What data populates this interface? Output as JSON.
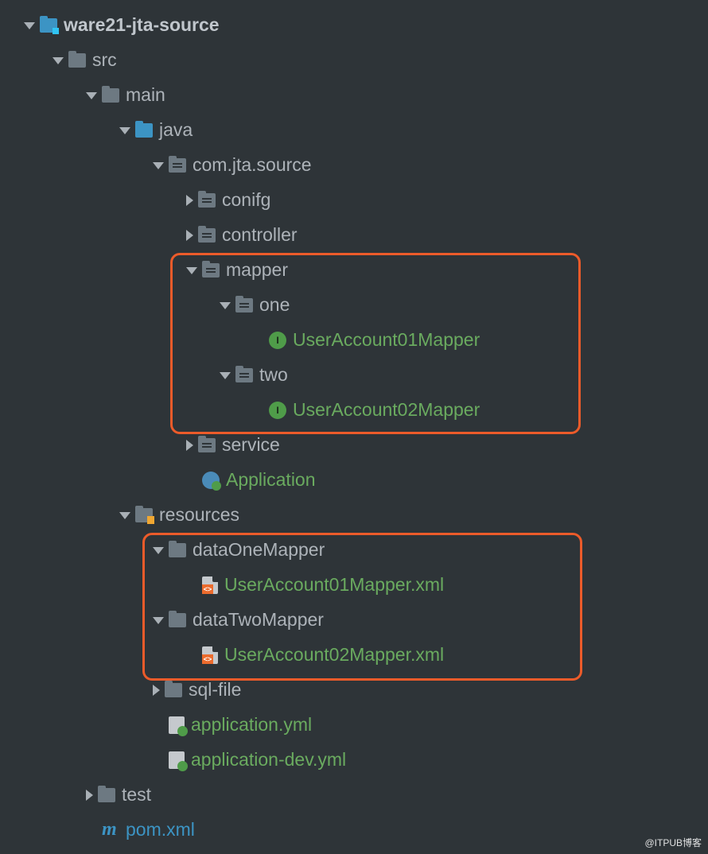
{
  "tree": {
    "root": "ware21-jta-source",
    "src": "src",
    "main": "main",
    "java": "java",
    "pkg": "com.jta.source",
    "conifg": "conifg",
    "controller": "controller",
    "mapper": "mapper",
    "one": "one",
    "ua01mapper": "UserAccount01Mapper",
    "two": "two",
    "ua02mapper": "UserAccount02Mapper",
    "service": "service",
    "application": "Application",
    "resources": "resources",
    "dataOneMapper": "dataOneMapper",
    "ua01xml": "UserAccount01Mapper.xml",
    "dataTwoMapper": "dataTwoMapper",
    "ua02xml": "UserAccount02Mapper.xml",
    "sqlfile": "sql-file",
    "appyml": "application.yml",
    "appdevyml": "application-dev.yml",
    "test": "test",
    "pom": "pom.xml"
  },
  "watermark": "@ITPUB博客",
  "interface_letter": "I",
  "pom_letter": "m"
}
